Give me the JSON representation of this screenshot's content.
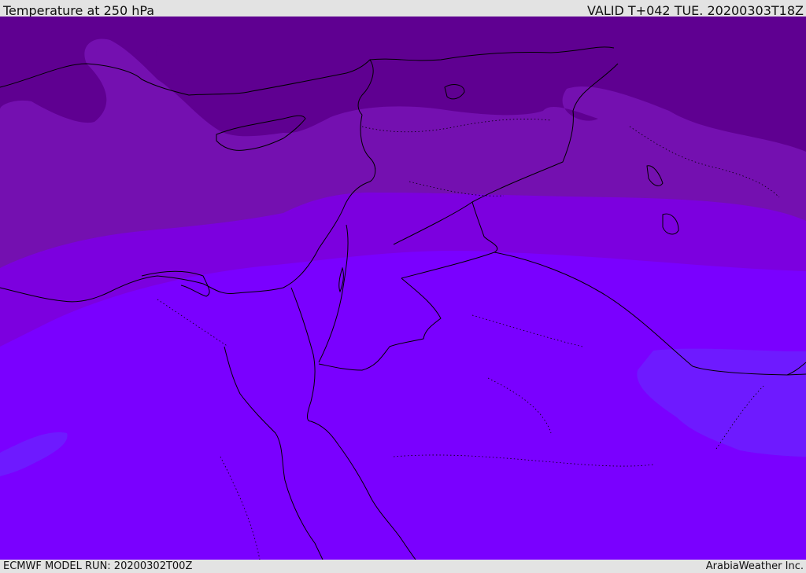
{
  "header": {
    "title": "Temperature at 250 hPa",
    "valid": "VALID T+042 TUE. 20200303T18Z"
  },
  "footer": {
    "model_run": "ECMWF MODEL RUN: 20200302T00Z",
    "credit": "ArabiaWeather Inc."
  },
  "map": {
    "colors": {
      "coldest": "#5f0091",
      "cold": "#7410b0",
      "cool": "#7c00df",
      "base": "#7a00ff",
      "warm": "#6e1aff",
      "coast": "#000000"
    }
  }
}
